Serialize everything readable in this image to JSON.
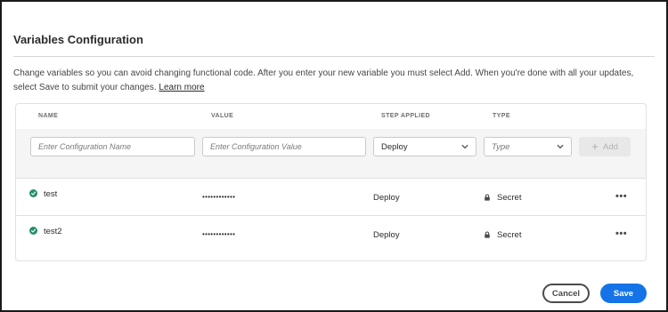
{
  "dialog": {
    "title": "Variables Configuration",
    "description": "Change variables so you can avoid changing functional code. After you enter your new variable you must select Add. When you're done with all your updates, select Save to submit your changes.",
    "learn_more": "Learn more"
  },
  "table": {
    "headers": {
      "name": "NAME",
      "value": "VALUE",
      "step": "STEP APPLIED",
      "type": "TYPE"
    },
    "form": {
      "name_placeholder": "Enter Configuration Name",
      "value_placeholder": "Enter Configuration Value",
      "step_selected": "Deploy",
      "type_placeholder": "Type",
      "add_label": "Add"
    },
    "rows": [
      {
        "name": "test",
        "value": "••••••••••••",
        "step": "Deploy",
        "type": "Secret",
        "status_icon": "check-circle-icon"
      },
      {
        "name": "test2",
        "value": "••••••••••••",
        "step": "Deploy",
        "type": "Secret",
        "status_icon": "check-circle-icon"
      }
    ],
    "more_label": "•••"
  },
  "footer": {
    "cancel_label": "Cancel",
    "save_label": "Save"
  },
  "colors": {
    "accent": "#1473e6",
    "success": "#268e6c",
    "border": "#1a1a1a"
  }
}
